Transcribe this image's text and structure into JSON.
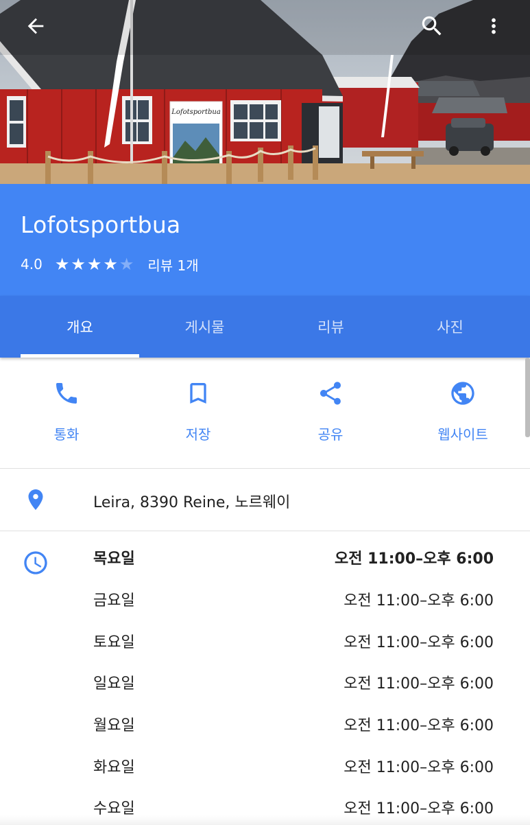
{
  "header": {
    "place_name": "Lofotsportbua",
    "rating": "4.0",
    "stars": {
      "value": 4,
      "max": 5
    },
    "review_count": "리뷰 1개",
    "top_icons": [
      "back-arrow-icon",
      "search-icon",
      "more-vert-icon"
    ]
  },
  "tabs": [
    {
      "label": "개요",
      "active": true
    },
    {
      "label": "게시물",
      "active": false
    },
    {
      "label": "리뷰",
      "active": false
    },
    {
      "label": "사진",
      "active": false
    }
  ],
  "actions": [
    {
      "label": "통화",
      "icon": "phone-icon"
    },
    {
      "label": "저장",
      "icon": "bookmark-icon"
    },
    {
      "label": "공유",
      "icon": "share-icon"
    },
    {
      "label": "웹사이트",
      "icon": "globe-icon"
    }
  ],
  "address": {
    "text": "Leira, 8390 Reine, 노르웨이",
    "icon": "location-pin-icon"
  },
  "hours": {
    "icon": "clock-icon",
    "rows": [
      {
        "day": "목요일",
        "time": "오전 11:00–오후 6:00",
        "today": true
      },
      {
        "day": "금요일",
        "time": "오전 11:00–오후 6:00",
        "today": false
      },
      {
        "day": "토요일",
        "time": "오전 11:00–오후 6:00",
        "today": false
      },
      {
        "day": "일요일",
        "time": "오전 11:00–오후 6:00",
        "today": false
      },
      {
        "day": "월요일",
        "time": "오전 11:00–오후 6:00",
        "today": false
      },
      {
        "day": "화요일",
        "time": "오전 11:00–오후 6:00",
        "today": false
      },
      {
        "day": "수요일",
        "time": "오전 11:00–오후 6:00",
        "today": false
      }
    ]
  },
  "photo": {
    "sign_text": "Lofotsportbua"
  },
  "colors": {
    "primary_blue": "#4285f4",
    "tab_blue": "#3b78e7",
    "text_dark": "#212121",
    "divider": "#e0e0e0"
  }
}
